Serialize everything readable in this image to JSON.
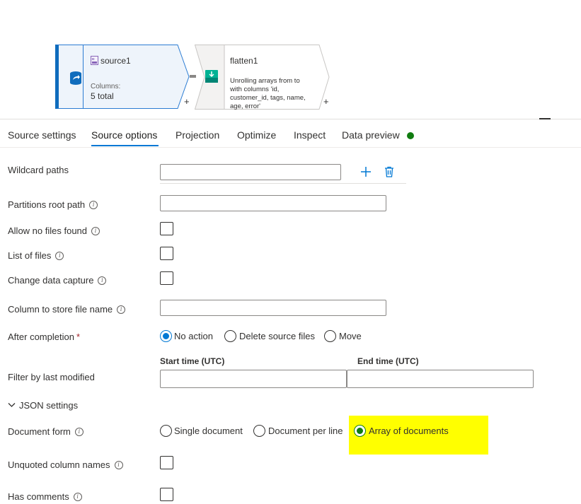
{
  "pipeline": {
    "source_node": {
      "title": "source1",
      "columns_label": "Columns:",
      "columns_value": "5 total",
      "add_symbol": "+"
    },
    "flatten_node": {
      "title": "flatten1",
      "description_line1": "Unrolling arrays from  to",
      "description_line2": "with columns 'id,",
      "description_line3": "customer_id, tags, name,",
      "description_line4": "age, error'",
      "add_symbol": "+"
    }
  },
  "tabs": [
    {
      "label": "Source settings"
    },
    {
      "label": "Source options"
    },
    {
      "label": "Projection"
    },
    {
      "label": "Optimize"
    },
    {
      "label": "Inspect"
    },
    {
      "label": "Data preview"
    }
  ],
  "active_tab": "Source options",
  "status_color": "#107c10",
  "form": {
    "wildcard_paths": {
      "label": "Wildcard paths",
      "value": ""
    },
    "partitions_root_path": {
      "label": "Partitions root path",
      "value": ""
    },
    "allow_no_files_found": {
      "label": "Allow no files found",
      "checked": false
    },
    "list_of_files": {
      "label": "List of files",
      "checked": false
    },
    "change_data_capture": {
      "label": "Change data capture",
      "checked": false
    },
    "column_to_store_file_name": {
      "label": "Column to store file name",
      "value": ""
    },
    "after_completion": {
      "label": "After completion",
      "required_mark": "*",
      "options": [
        "No action",
        "Delete source files",
        "Move"
      ],
      "selected": "No action"
    },
    "filter_by_last_modified": {
      "label": "Filter by last modified",
      "start_label": "Start time (UTC)",
      "end_label": "End time (UTC)",
      "start_value": "",
      "end_value": ""
    },
    "json_settings": {
      "label": "JSON settings",
      "expanded": true
    },
    "document_form": {
      "label": "Document form",
      "options": [
        "Single document",
        "Document per line",
        "Array of documents"
      ],
      "selected": "Array of documents",
      "highlight_color": "#ffff00"
    },
    "unquoted_column_names": {
      "label": "Unquoted column names",
      "checked": false
    },
    "has_comments": {
      "label": "Has comments",
      "checked": false
    }
  },
  "colors": {
    "accent": "#0078d4",
    "success": "#107c10"
  }
}
